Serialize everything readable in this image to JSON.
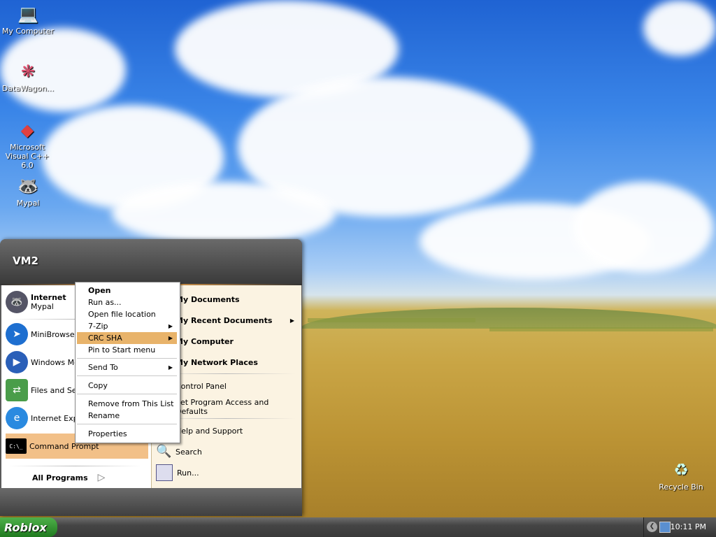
{
  "desktop": {
    "icons": [
      {
        "label": "My Computer",
        "icon": "my-computer-icon"
      },
      {
        "label": "DataWagon...",
        "icon": "datawagon-icon"
      },
      {
        "label": "Microsoft Visual C++ 6.0",
        "icon": "visual-cpp-icon"
      },
      {
        "label": "Mypal",
        "icon": "mypal-icon"
      },
      {
        "label": "Recycle Bin",
        "icon": "recycle-bin-icon"
      }
    ]
  },
  "start_menu": {
    "user": "VM2",
    "pinned": [
      {
        "title": "Internet",
        "subtitle": "Mypal",
        "icon": "mypal-icon"
      },
      {
        "title": "MiniBrowser",
        "icon": "minibrowser-icon"
      },
      {
        "title": "Windows Med",
        "icon": "windows-media-icon"
      },
      {
        "title": "Files and Set",
        "icon": "files-settings-icon"
      },
      {
        "title": "Internet Exp",
        "icon": "internet-explorer-icon"
      },
      {
        "title": "Command Prompt",
        "icon": "command-prompt-icon"
      }
    ],
    "all_programs": "All Programs",
    "right": [
      {
        "label": "My Documents",
        "bold": true
      },
      {
        "label": "My Recent Documents",
        "bold": true,
        "arrow": true
      },
      {
        "label": "My Computer",
        "bold": true
      },
      {
        "label": "My Network Places",
        "bold": true
      },
      {
        "label": "Control Panel",
        "bold": false
      },
      {
        "label": "Set Program Access and Defaults",
        "bold": false
      },
      {
        "label": "Help and Support",
        "bold": false
      },
      {
        "label": "Search",
        "bold": false
      },
      {
        "label": "Run...",
        "bold": false
      }
    ]
  },
  "context_menu": {
    "items": [
      "Open",
      "Run as...",
      "Open file location",
      "7-Zip",
      "CRC SHA",
      "Pin to Start menu",
      "Send To",
      "Copy",
      "Remove from This List",
      "Rename",
      "Properties"
    ],
    "selected": "CRC SHA"
  },
  "taskbar": {
    "start_label": "Roblox",
    "clock": "10:11 PM"
  }
}
